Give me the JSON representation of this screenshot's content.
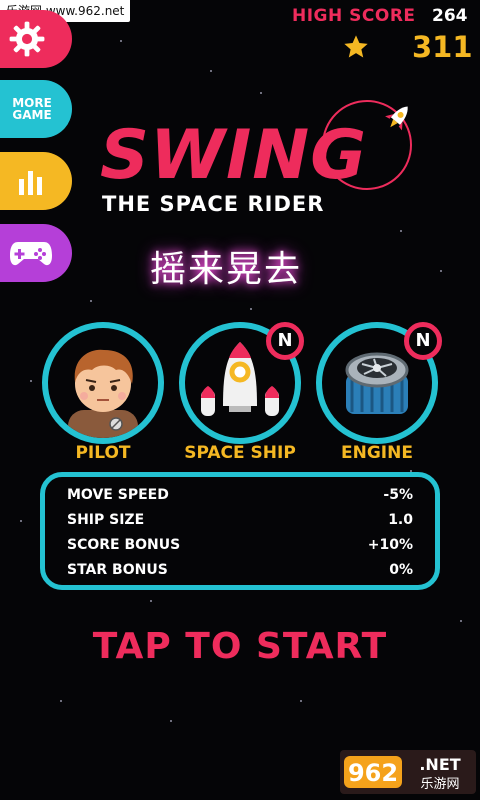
{
  "watermark": {
    "top_text": "乐游网 www.962.net",
    "logo_num": "962",
    "logo_net": ".NET",
    "logo_sub": "乐游网"
  },
  "header": {
    "high_score_label": "HIGH SCORE",
    "high_score_value": "264",
    "stars": "311"
  },
  "side_menu": {
    "more_line1": "MORE",
    "more_line2": "GAME"
  },
  "title": {
    "main": "SWING",
    "subtitle": "THE SPACE RIDER",
    "chinese": "摇来晃去"
  },
  "items": [
    {
      "label": "PILOT",
      "badge": ""
    },
    {
      "label": "SPACE SHIP",
      "badge": "N"
    },
    {
      "label": "ENGINE",
      "badge": "N"
    }
  ],
  "stats": [
    {
      "name": "MOVE SPEED",
      "value": "-5%"
    },
    {
      "name": "SHIP SIZE",
      "value": "1.0"
    },
    {
      "name": "SCORE BONUS",
      "value": "+10%"
    },
    {
      "name": "STAR BONUS",
      "value": "0%"
    }
  ],
  "cta": {
    "label": "TAP TO START"
  },
  "colors": {
    "pink": "#ee2c5c",
    "cyan": "#24c2d2",
    "yellow": "#f5b823",
    "purple": "#b53fd8"
  },
  "icons": {
    "settings": "gear-icon",
    "stats": "bar-chart-icon",
    "games": "gamepad-icon",
    "star": "star-icon"
  }
}
